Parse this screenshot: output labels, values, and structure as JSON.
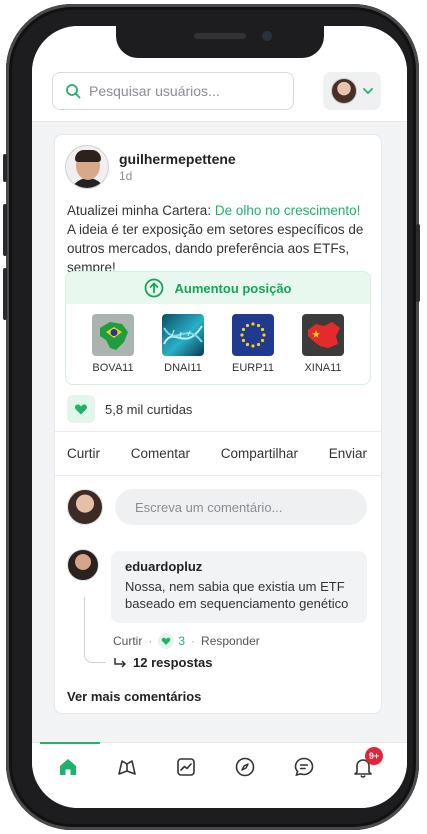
{
  "colors": {
    "accent": "#1fb26a",
    "accent_light": "#e3f6ec",
    "badge_red": "#e0243a"
  },
  "header": {
    "search_placeholder": "Pesquisar usuários...",
    "search_icon": "search-icon",
    "profile_dropdown_icon": "chevron-down-icon"
  },
  "post": {
    "author": "guilhermepettene",
    "time": "1d",
    "text_prefix": "Atualizei minha Cartera: ",
    "portfolio_link": "De olho no crescimento!",
    "text_body": "A ideia é ter exposição em setores específicos de outros mercados, dando preferência aos ETFs, sempre!",
    "position_title": "Aumentou posição",
    "assets": [
      {
        "ticker": "BOVA11",
        "image": "brazil-map"
      },
      {
        "ticker": "DNAI11",
        "image": "dna-helix"
      },
      {
        "ticker": "EURP11",
        "image": "eu-flag"
      },
      {
        "ticker": "XINA11",
        "image": "china-map"
      }
    ],
    "reactions": "5,8 mil curtidas"
  },
  "actions": {
    "like": "Curtir",
    "comment": "Comentar",
    "share": "Compartilhar",
    "send": "Enviar"
  },
  "comment_box": {
    "placeholder": "Escreva um comentário..."
  },
  "reply": {
    "author": "eduardopluz",
    "text": "Nossa, nem sabia que existia um ETF baseado em sequenciamento genético",
    "like_label": "Curtir",
    "like_count": "3",
    "reply_label": "Responder",
    "replies_link": "12 respostas"
  },
  "more_comments": "Ver mais comentários",
  "tabbar": {
    "tabs": [
      "home-icon",
      "wallet-icon",
      "chart-icon",
      "compass-icon",
      "chat-icon",
      "bell-icon"
    ],
    "notification_badge": "9+"
  }
}
